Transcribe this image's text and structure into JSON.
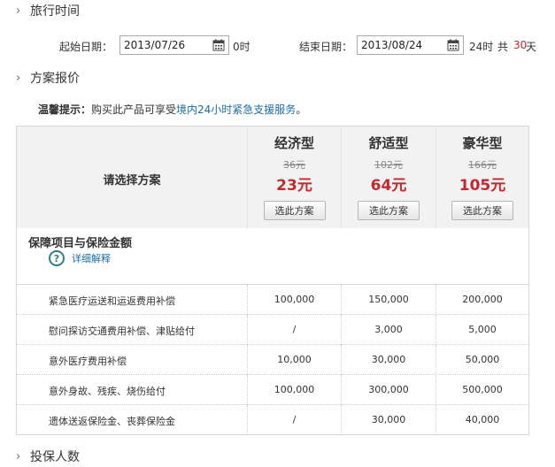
{
  "sections": {
    "travel_time": "旅行时间",
    "plan_quote": "方案报价",
    "insured_count": "投保人数"
  },
  "dates": {
    "start_label": "起始日期：",
    "start_value": "2013/07/26",
    "start_hour": "0时",
    "end_label": "结束日期：",
    "end_value": "2013/08/24",
    "end_hour": "24时",
    "total_label": "共",
    "total_days": "30",
    "days_unit": "天"
  },
  "tip": {
    "label": "温馨提示：",
    "text": "购买此产品可享受",
    "link_text": "境内24小时紧急支援服务",
    "end": "。"
  },
  "plans_header": {
    "choose_label": "请选择方案"
  },
  "plans": [
    {
      "name": "经济型",
      "original_price": "36元",
      "price": "23元",
      "button": "选此方案"
    },
    {
      "name": "舒适型",
      "original_price": "102元",
      "price": "64元",
      "button": "选此方案"
    },
    {
      "name": "豪华型",
      "original_price": "166元",
      "price": "105元",
      "button": "选此方案"
    }
  ],
  "coverage": {
    "title": "保障项目与保险金额",
    "help_link": "详细解释",
    "rows": [
      {
        "name": "紧急医疗运送和运返费用补偿",
        "values": [
          "100,000",
          "150,000",
          "200,000"
        ]
      },
      {
        "name": "慰问探访交通费用补偿、津贴给付",
        "values": [
          "/",
          "3,000",
          "5,000"
        ]
      },
      {
        "name": "意外医疗费用补偿",
        "values": [
          "10,000",
          "30,000",
          "50,000"
        ]
      },
      {
        "name": "意外身故、残疾、烧伤给付",
        "values": [
          "100,000",
          "300,000",
          "500,000"
        ]
      },
      {
        "name": "遗体送返保险金、丧葬保险金",
        "values": [
          "/",
          "30,000",
          "40,000"
        ]
      }
    ]
  },
  "icons": {
    "section": "chevron-right-icon",
    "calendar": "calendar-icon",
    "help": "question-circle-icon"
  },
  "colors": {
    "price_red": "#c4282d",
    "link_blue": "#1c6ea4",
    "header_gray": "#f2f2f2"
  }
}
